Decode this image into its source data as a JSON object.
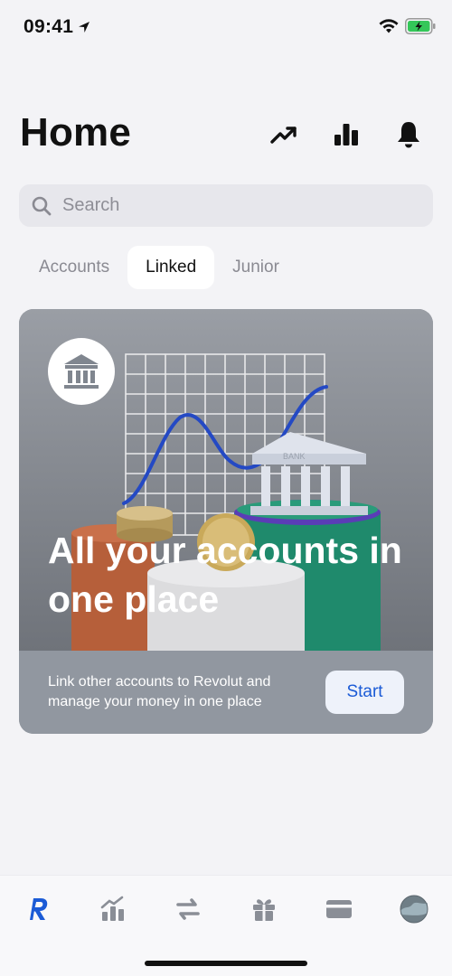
{
  "status_bar": {
    "time": "09:41"
  },
  "header": {
    "title": "Home"
  },
  "search": {
    "placeholder": "Search"
  },
  "tabs": [
    {
      "label": "Accounts",
      "active": false
    },
    {
      "label": "Linked",
      "active": true
    },
    {
      "label": "Junior",
      "active": false
    }
  ],
  "card": {
    "title": "All your accounts in one place",
    "description": "Link other accounts to Revolut and manage your money in one place",
    "button_label": "Start",
    "illustration_sign": "BANK"
  },
  "colors": {
    "accent_blue": "#1b5bd6",
    "battery_green": "#34c759",
    "card_bg": "#8c9097"
  },
  "icons": {
    "header": [
      "trending-up-icon",
      "bar-chart-icon",
      "bell-icon"
    ],
    "tabbar": [
      "revolut-logo-icon",
      "stocks-icon",
      "transfer-icon",
      "gift-icon",
      "card-icon",
      "profile-avatar"
    ]
  }
}
